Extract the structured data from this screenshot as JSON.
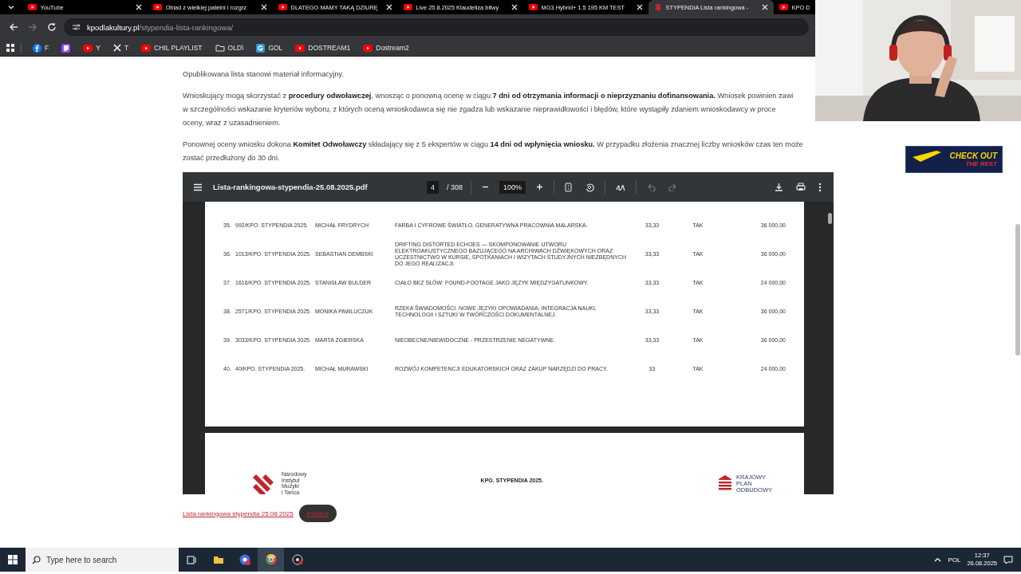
{
  "browser": {
    "tabs": [
      {
        "title": "YouTube",
        "selected": false
      },
      {
        "title": "Obiad z wielkiej patelni i rozgrz",
        "selected": false
      },
      {
        "title": "DLATEGO MAMY TAKĄ DZIURĘ",
        "selected": false
      },
      {
        "title": "Live 25.8.2025 Klaudeliza bitwy",
        "selected": false
      },
      {
        "title": "MG3 Hybrid+ 1.5 195 KM TEST",
        "selected": false
      },
      {
        "title": "STYPENDIA Lista rankingowa -",
        "selected": true
      },
      {
        "title": "KPO D",
        "selected": false
      }
    ],
    "address": {
      "domain": "kpodlakultury.pl",
      "path": "/stypendia-lista-rankingowa/"
    },
    "bookmarks": [
      {
        "kind": "facebook",
        "label": "F"
      },
      {
        "kind": "twitch"
      },
      {
        "kind": "youtube",
        "label": "Y"
      },
      {
        "kind": "x",
        "label": "T"
      },
      {
        "kind": "youtube",
        "label": "CHIL PLAYLIST"
      },
      {
        "kind": "folder",
        "label": "OLD\\"
      },
      {
        "kind": "g",
        "label": "GOL"
      },
      {
        "kind": "youtube",
        "label": "DOSTREAM1"
      },
      {
        "kind": "youtube",
        "label": "Dostream2"
      }
    ]
  },
  "article": {
    "paragraphs": [
      [
        "Opublikowana lista stanowi materiał informacyjny."
      ],
      [
        "Wnioskujący mogą skorzystać z **procedury odwoławczej**, wnosząc o ponowną ocenę w ciągu **7 dni od otrzymania informacji o nieprzyznaniu dofinansowania.** Wniosek powinien zawi",
        "w szczególności wskazanie kryteriów wyboru, z których oceną wnioskodawca się nie zgadza lub wskazanie nieprawidłowości i błędów, które wystąpiły zdaniem wnioskodawcy w proce",
        "oceny, wraz z uzasadnieniem."
      ],
      [
        "Ponownej oceny wniosku dokona **Komitet Odwoławczy** składający się z 5 ekspertów w ciągu **14 dni od wpłynięcia wniosku.** W przypadku złożenia znacznej liczby wniosków czas ten może",
        "zostać przedłużony do 30 dni."
      ]
    ],
    "pdf_viewer": {
      "filename": "Lista-rankingowa-stypendia-25.08.2025.pdf",
      "page": "4",
      "page_count": "/ 308",
      "zoom": "100%",
      "rows": [
        {
          "no": "35.",
          "id": "992/KPO. STYPENDIA 2025.",
          "name": "MICHAŁ FRYDRYCH",
          "title": "FARBA I CYFROWE ŚWIATŁO. GENERATYWNA PRACOWNIA MALARSKA.",
          "score": "33,33",
          "eligible": "TAK",
          "amount": "36 000,00"
        },
        {
          "no": "36.",
          "id": "1013/KPO. STYPENDIA 2025.",
          "name": "SEBASTIAN DEMBSKI",
          "title": "DRIFTING DISTORTED ECHOES — SKOMPONOWANIE UTWORU ELEKTROAKUSTYCZNEGO BAZUJĄCEGO NA ARCHIWACH DŹWIĘKOWYCH ORAZ UCZESTNICTWO W KURSIE, SPOTKANIACH I WIZYTACH STUDYJNYCH NIEZBĘDNYCH DO JEGO REALIZACJI.",
          "score": "33,33",
          "eligible": "TAK",
          "amount": "36 000,00"
        },
        {
          "no": "37.",
          "id": "1616/KPO. STYPENDIA 2025.",
          "name": "STANISŁAW BULDER",
          "title": "CIAŁO BEZ SŁÓW: FOUND-FOOTAGE JAKO JĘZYK MIĘDZYGATUNKOWY.",
          "score": "33,33",
          "eligible": "TAK",
          "amount": "24 000,00"
        },
        {
          "no": "38.",
          "id": "2571/KPO. STYPENDIA 2025.",
          "name": "MONIKA PAWLUCZUK",
          "title": "RZEKA ŚWIADOMOŚCI. NOWE JĘZYKI OPOWIADANIA: INTEGRACJA NAUKI, TECHNOLOGII I SZTUKI W TWÓRCZOŚCI DOKUMENTALNEJ.",
          "score": "33,33",
          "eligible": "TAK",
          "amount": "36 000,00"
        },
        {
          "no": "39.",
          "id": "3033/KPO. STYPENDIA 2025.",
          "name": "MARTA ZGIERSKA",
          "title": "NIEOBECNE/NIEWIDOCZNE - PRZESTRZENIE NEGATYWNE.",
          "score": "33,33",
          "eligible": "TAK",
          "amount": "36 000,00"
        },
        {
          "no": "40.",
          "id": "40/KPO. STYPENDIA 2025.",
          "name": "MICHAŁ MURAWSKI",
          "title": "ROZWÓJ KOMPETENCJI EDUKATORSKICH ORAZ ZAKUP NARZĘDZI DO PRACY.",
          "score": "33",
          "eligible": "TAK",
          "amount": "24 000,00"
        }
      ],
      "next_page": {
        "left_logo_lines": [
          "Narodowy",
          "Instytut",
          "Muzyki",
          "i Tańca"
        ],
        "heading": "KPO. STYPENDIA 2025.",
        "right_logo_lines": [
          "KRAJOWY",
          "PLAN",
          "ODBUDOWY"
        ]
      }
    },
    "download_link": "Lista rankingowa stypendia 25.08.2025",
    "download_button": "Pobierz"
  },
  "overlay": {
    "banner_top": "CHECK OUT",
    "banner_bottom": "THE REST"
  },
  "taskbar": {
    "search_placeholder": "Type here to search",
    "language": "POL",
    "time": "12:37",
    "date": "26.08.2025"
  }
}
